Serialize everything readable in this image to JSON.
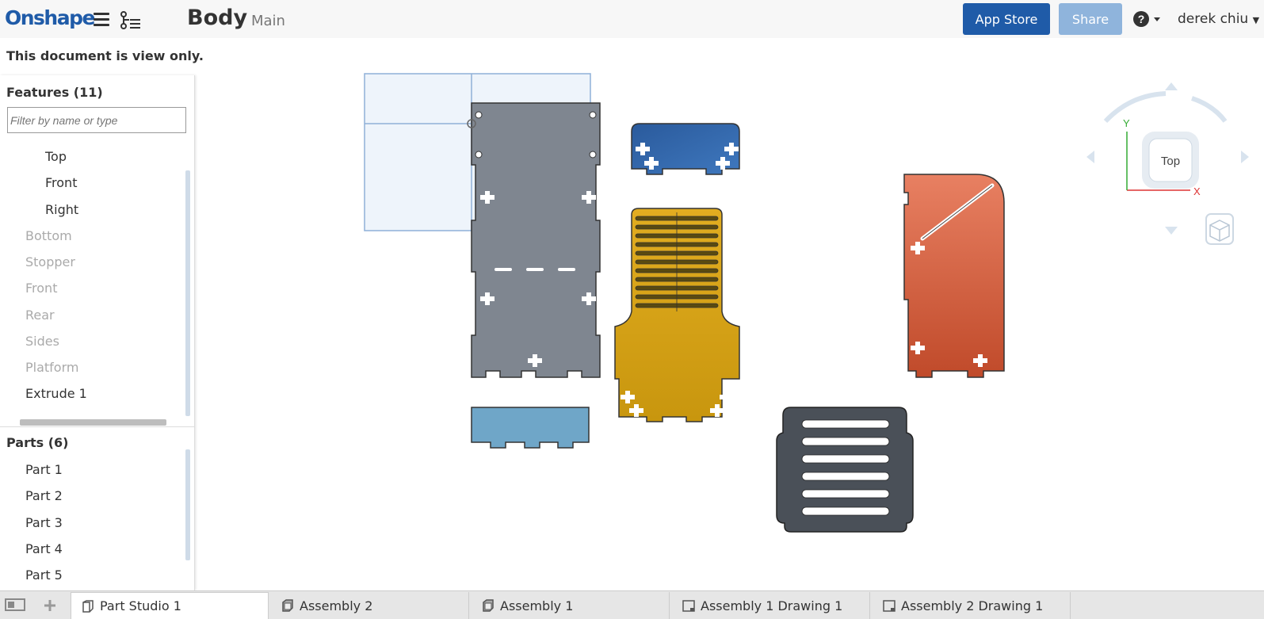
{
  "app": {
    "logo": "Onshape"
  },
  "header": {
    "title": "Body",
    "branch": "Main",
    "app_store_label": "App Store",
    "share_label": "Share",
    "user_name": "derek chiu"
  },
  "notice": "This document is view only.",
  "features": {
    "header": "Features (11)",
    "filter_placeholder": "Filter by name or type",
    "items": [
      "Top",
      "Front",
      "Right",
      "Bottom",
      "Stopper",
      "Front",
      "Rear",
      "Sides",
      "Platform",
      "Extrude 1"
    ]
  },
  "parts": {
    "header": "Parts (6)",
    "items": [
      "Part 1",
      "Part 2",
      "Part 3",
      "Part 4",
      "Part 5"
    ]
  },
  "viewcube": {
    "face_label": "Top",
    "x_axis": "X",
    "y_axis": "Y"
  },
  "tabs": [
    {
      "label": "Part Studio 1",
      "icon": "part-studio-icon"
    },
    {
      "label": "Assembly 2",
      "icon": "assembly-icon"
    },
    {
      "label": "Assembly 1",
      "icon": "assembly-icon"
    },
    {
      "label": "Assembly 1 Drawing 1",
      "icon": "drawing-icon"
    },
    {
      "label": "Assembly 2 Drawing 1",
      "icon": "drawing-icon"
    }
  ],
  "colors": {
    "brand": "#1f5ba8",
    "share": "#8fb4dc",
    "part_grey": "#7f8690",
    "part_blue": "#2f63a6",
    "part_gold": "#d4a017",
    "part_orange": "#d4583a",
    "part_lightblue": "#6fa6c8",
    "part_dark": "#4a5058"
  }
}
